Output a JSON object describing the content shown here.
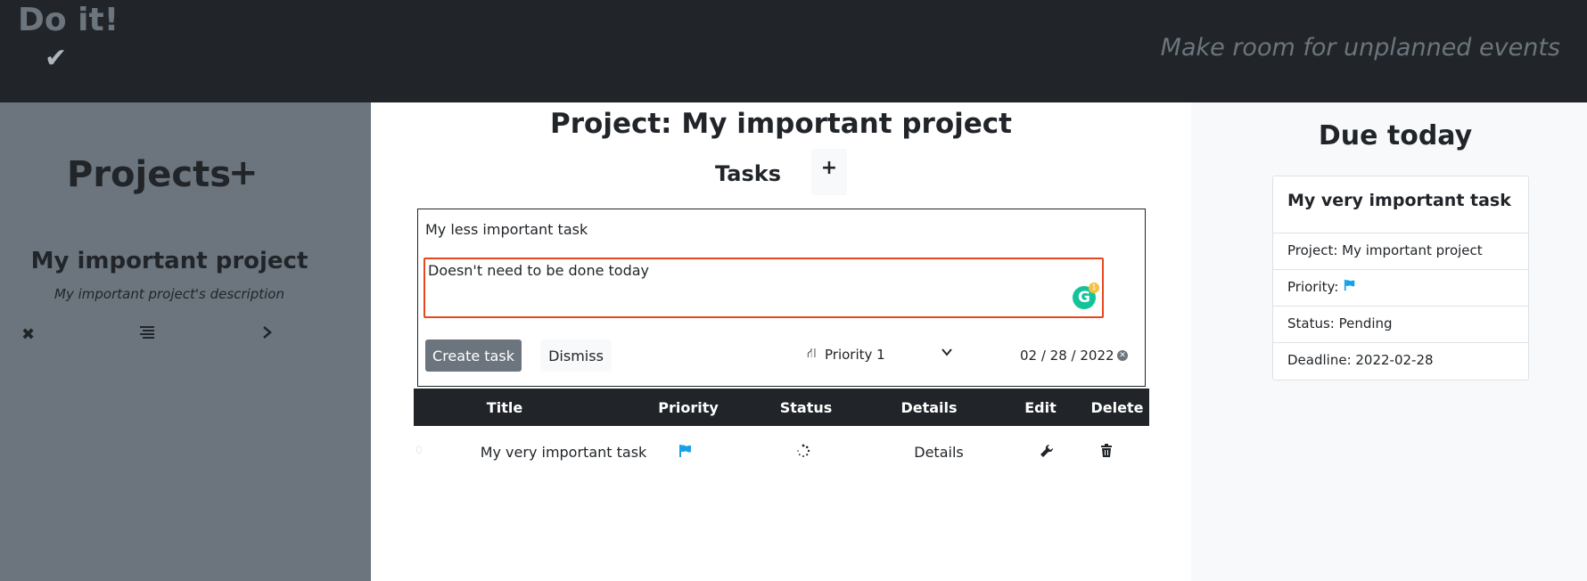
{
  "header": {
    "brand": "Do it!",
    "brand_icon": "check-icon",
    "tagline": "Make room for unplanned events"
  },
  "sidebar": {
    "title": "Projects",
    "add_label": "+",
    "project": {
      "name": "My important project",
      "description": "My important project's description",
      "actions": [
        "close-icon",
        "list-icon",
        "chevron-right-icon"
      ]
    }
  },
  "main": {
    "title": "Project: My important project",
    "tasks_label": "Tasks",
    "tasks_add_label": "+",
    "form": {
      "title_value": "My less important task",
      "description_value": "Doesn't need to be done today",
      "grammarly_label": "G",
      "grammarly_count": "1",
      "create_label": "Create task",
      "dismiss_label": "Dismiss",
      "priority_selected": "Priority 1",
      "date_value": "02 / 28 / 2022"
    },
    "table": {
      "columns": [
        "Title",
        "Priority",
        "Status",
        "Details",
        "Edit",
        "Delete"
      ],
      "rows": [
        {
          "index": "0",
          "title": "My very important task",
          "priority_icon": "flag-icon",
          "status_icon": "spinner-icon",
          "details": "Details",
          "edit_icon": "wrench-icon",
          "delete_icon": "trash-icon"
        }
      ]
    }
  },
  "due_today": {
    "title": "Due today",
    "card": {
      "task_title": "My very important task",
      "project": "Project: My important project",
      "priority_label": "Priority:",
      "status": "Status: Pending",
      "deadline": "Deadline: 2022-02-28"
    }
  },
  "colors": {
    "header_bg": "#212529",
    "sidebar_bg": "#6c757d",
    "right_bg": "#f8f9fa",
    "focus_border": "#e8461f",
    "flag": "#17a2e8"
  }
}
